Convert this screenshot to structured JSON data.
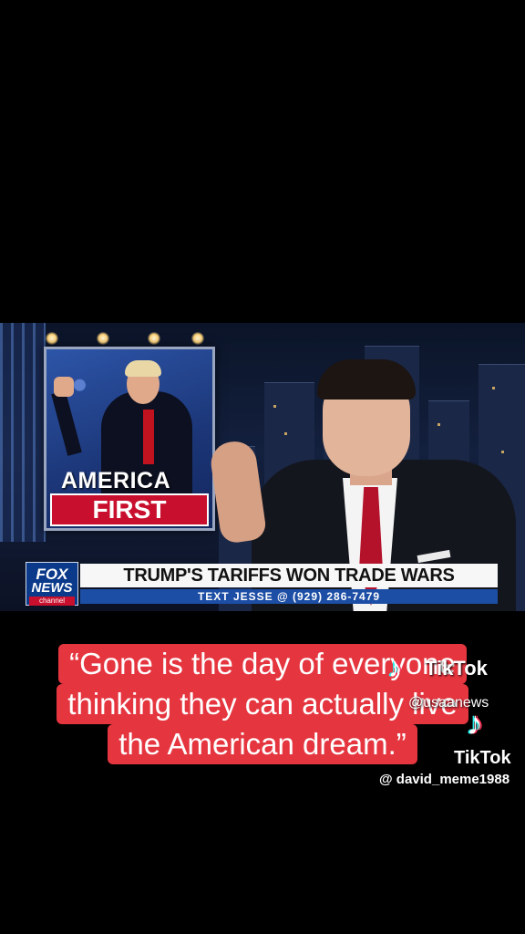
{
  "video": {
    "monitor": {
      "line1": "AMERICA",
      "line2": "FIRST"
    },
    "chyron": {
      "logo_fox": "FOX",
      "logo_news": "NEWS",
      "logo_channel": "channel",
      "headline": "TRUMP'S TARIFFS WON TRADE WARS",
      "subline": "TEXT JESSE @ (929) 286-7479"
    }
  },
  "caption": {
    "line1": "“Gone is the day of everyone",
    "line2": "thinking they can actually live",
    "line3": "the American dream.”"
  },
  "watermarks": {
    "top": {
      "icon": "tiktok-icon",
      "brand": "TikTok",
      "handle": "@usaanews"
    },
    "bottom": {
      "icon": "tiktok-icon",
      "brand": "TikTok",
      "handle": "@ david_meme1988"
    }
  }
}
